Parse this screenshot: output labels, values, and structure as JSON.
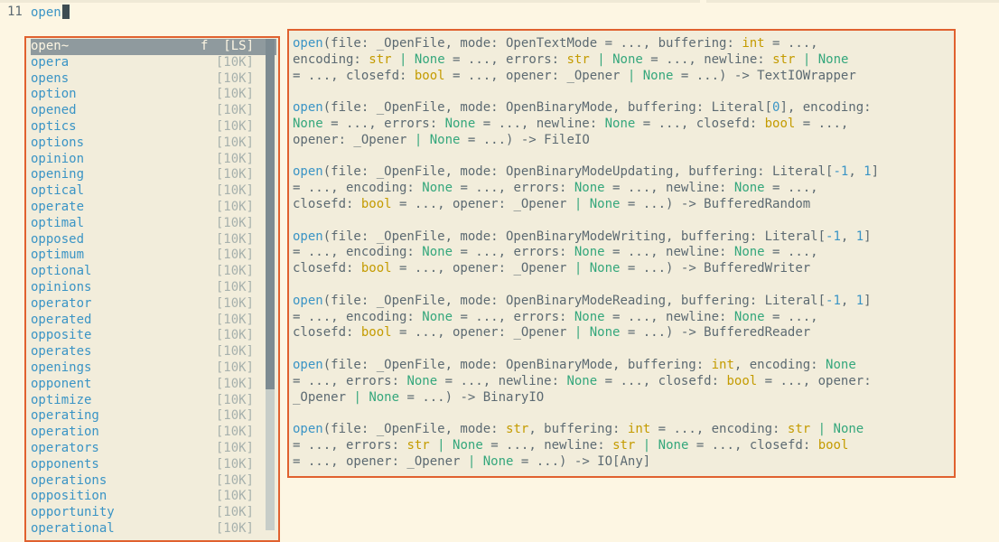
{
  "editor": {
    "line_number": "11",
    "typed_text": "open"
  },
  "completion": {
    "selected": {
      "word": "open~",
      "kind": "f",
      "menu": "[LS]"
    },
    "match_prefix_lengths_note": "",
    "items": [
      {
        "match": "op",
        "rest": "era",
        "menu": "[10K]"
      },
      {
        "match": "op",
        "rest": "ens",
        "menu": "[10K]"
      },
      {
        "match": "op",
        "rest": "tion",
        "menu": "[10K]"
      },
      {
        "match": "op",
        "rest": "ened",
        "menu": "[10K]"
      },
      {
        "match": "op",
        "rest": "tics",
        "menu": "[10K]"
      },
      {
        "match": "op",
        "rest": "tions",
        "menu": "[10K]"
      },
      {
        "match": "op",
        "rest": "inion",
        "menu": "[10K]"
      },
      {
        "match": "op",
        "rest": "ening",
        "menu": "[10K]"
      },
      {
        "match": "op",
        "rest": "tical",
        "menu": "[10K]"
      },
      {
        "match": "op",
        "rest": "erate",
        "menu": "[10K]"
      },
      {
        "match": "op",
        "rest": "timal",
        "menu": "[10K]"
      },
      {
        "match": "op",
        "rest": "posed",
        "menu": "[10K]"
      },
      {
        "match": "op",
        "rest": "timum",
        "menu": "[10K]"
      },
      {
        "match": "op",
        "rest": "tional",
        "menu": "[10K]"
      },
      {
        "match": "op",
        "rest": "inions",
        "menu": "[10K]"
      },
      {
        "match": "op",
        "rest": "erator",
        "menu": "[10K]"
      },
      {
        "match": "op",
        "rest": "erated",
        "menu": "[10K]"
      },
      {
        "match": "op",
        "rest": "posite",
        "menu": "[10K]"
      },
      {
        "match": "op",
        "rest": "erates",
        "menu": "[10K]"
      },
      {
        "match": "op",
        "rest": "enings",
        "menu": "[10K]"
      },
      {
        "match": "op",
        "rest": "ponent",
        "menu": "[10K]"
      },
      {
        "match": "op",
        "rest": "timize",
        "menu": "[10K]"
      },
      {
        "match": "op",
        "rest": "erating",
        "menu": "[10K]"
      },
      {
        "match": "op",
        "rest": "eration",
        "menu": "[10K]"
      },
      {
        "match": "op",
        "rest": "erators",
        "menu": "[10K]"
      },
      {
        "match": "op",
        "rest": "ponents",
        "menu": "[10K]"
      },
      {
        "match": "op",
        "rest": "erations",
        "menu": "[10K]"
      },
      {
        "match": "op",
        "rest": "position",
        "menu": "[10K]"
      },
      {
        "match": "op",
        "rest": "portunity",
        "menu": "[10K]"
      },
      {
        "match": "op",
        "rest": "erational",
        "menu": "[10K]"
      }
    ],
    "scroll_position_fraction": 0.0,
    "scroll_visible_fraction": 0.71
  },
  "documentation": {
    "signatures": [
      [
        [
          [
            "fn",
            "open"
          ],
          [
            "p",
            "(file: _OpenFile, mode: OpenTextMode = ..., buffering: "
          ],
          [
            "ty",
            "int"
          ],
          [
            "p",
            " = ...,"
          ]
        ],
        [
          [
            "p",
            "encoding: "
          ],
          [
            "ty",
            "str"
          ],
          [
            "p",
            " "
          ],
          [
            "pipe",
            "|"
          ],
          [
            "p",
            " "
          ],
          [
            "none",
            "None"
          ],
          [
            "p",
            " = ..., errors: "
          ],
          [
            "ty",
            "str"
          ],
          [
            "p",
            " "
          ],
          [
            "pipe",
            "|"
          ],
          [
            "p",
            " "
          ],
          [
            "none",
            "None"
          ],
          [
            "p",
            " = ..., newline: "
          ],
          [
            "ty",
            "str"
          ],
          [
            "p",
            " "
          ],
          [
            "pipe",
            "|"
          ],
          [
            "p",
            " "
          ],
          [
            "none",
            "None"
          ]
        ],
        [
          [
            "p",
            "= ..., closefd: "
          ],
          [
            "ty",
            "bool"
          ],
          [
            "p",
            " = ..., opener: _Opener "
          ],
          [
            "pipe",
            "|"
          ],
          [
            "p",
            " "
          ],
          [
            "none",
            "None"
          ],
          [
            "p",
            " = ...) -> TextIOWrapper"
          ]
        ]
      ],
      [
        [
          [
            "fn",
            "open"
          ],
          [
            "p",
            "(file: _OpenFile, mode: OpenBinaryMode, buffering: Literal["
          ],
          [
            "num",
            "0"
          ],
          [
            "p",
            "], encoding:"
          ]
        ],
        [
          [
            "none",
            "None"
          ],
          [
            "p",
            " = ..., errors: "
          ],
          [
            "none",
            "None"
          ],
          [
            "p",
            " = ..., newline: "
          ],
          [
            "none",
            "None"
          ],
          [
            "p",
            " = ..., closefd: "
          ],
          [
            "ty",
            "bool"
          ],
          [
            "p",
            " = ...,"
          ]
        ],
        [
          [
            "p",
            "opener: _Opener "
          ],
          [
            "pipe",
            "|"
          ],
          [
            "p",
            " "
          ],
          [
            "none",
            "None"
          ],
          [
            "p",
            " = ...) -> FileIO"
          ]
        ]
      ],
      [
        [
          [
            "fn",
            "open"
          ],
          [
            "p",
            "(file: _OpenFile, mode: OpenBinaryModeUpdating, buffering: Literal["
          ],
          [
            "num",
            "-1"
          ],
          [
            "p",
            ", "
          ],
          [
            "num",
            "1"
          ],
          [
            "p",
            "]"
          ]
        ],
        [
          [
            "p",
            "= ..., encoding: "
          ],
          [
            "none",
            "None"
          ],
          [
            "p",
            " = ..., errors: "
          ],
          [
            "none",
            "None"
          ],
          [
            "p",
            " = ..., newline: "
          ],
          [
            "none",
            "None"
          ],
          [
            "p",
            " = ...,"
          ]
        ],
        [
          [
            "p",
            "closefd: "
          ],
          [
            "ty",
            "bool"
          ],
          [
            "p",
            " = ..., opener: _Opener "
          ],
          [
            "pipe",
            "|"
          ],
          [
            "p",
            " "
          ],
          [
            "none",
            "None"
          ],
          [
            "p",
            " = ...) -> BufferedRandom"
          ]
        ]
      ],
      [
        [
          [
            "fn",
            "open"
          ],
          [
            "p",
            "(file: _OpenFile, mode: OpenBinaryModeWriting, buffering: Literal["
          ],
          [
            "num",
            "-1"
          ],
          [
            "p",
            ", "
          ],
          [
            "num",
            "1"
          ],
          [
            "p",
            "]"
          ]
        ],
        [
          [
            "p",
            "= ..., encoding: "
          ],
          [
            "none",
            "None"
          ],
          [
            "p",
            " = ..., errors: "
          ],
          [
            "none",
            "None"
          ],
          [
            "p",
            " = ..., newline: "
          ],
          [
            "none",
            "None"
          ],
          [
            "p",
            " = ...,"
          ]
        ],
        [
          [
            "p",
            "closefd: "
          ],
          [
            "ty",
            "bool"
          ],
          [
            "p",
            " = ..., opener: _Opener "
          ],
          [
            "pipe",
            "|"
          ],
          [
            "p",
            " "
          ],
          [
            "none",
            "None"
          ],
          [
            "p",
            " = ...) -> BufferedWriter"
          ]
        ]
      ],
      [
        [
          [
            "fn",
            "open"
          ],
          [
            "p",
            "(file: _OpenFile, mode: OpenBinaryModeReading, buffering: Literal["
          ],
          [
            "num",
            "-1"
          ],
          [
            "p",
            ", "
          ],
          [
            "num",
            "1"
          ],
          [
            "p",
            "]"
          ]
        ],
        [
          [
            "p",
            "= ..., encoding: "
          ],
          [
            "none",
            "None"
          ],
          [
            "p",
            " = ..., errors: "
          ],
          [
            "none",
            "None"
          ],
          [
            "p",
            " = ..., newline: "
          ],
          [
            "none",
            "None"
          ],
          [
            "p",
            " = ...,"
          ]
        ],
        [
          [
            "p",
            "closefd: "
          ],
          [
            "ty",
            "bool"
          ],
          [
            "p",
            " = ..., opener: _Opener "
          ],
          [
            "pipe",
            "|"
          ],
          [
            "p",
            " "
          ],
          [
            "none",
            "None"
          ],
          [
            "p",
            " = ...) -> BufferedReader"
          ]
        ]
      ],
      [
        [
          [
            "fn",
            "open"
          ],
          [
            "p",
            "(file: _OpenFile, mode: OpenBinaryMode, buffering: "
          ],
          [
            "ty",
            "int"
          ],
          [
            "p",
            ", encoding: "
          ],
          [
            "none",
            "None"
          ]
        ],
        [
          [
            "p",
            "= ..., errors: "
          ],
          [
            "none",
            "None"
          ],
          [
            "p",
            " = ..., newline: "
          ],
          [
            "none",
            "None"
          ],
          [
            "p",
            " = ..., closefd: "
          ],
          [
            "ty",
            "bool"
          ],
          [
            "p",
            " = ..., opener:"
          ]
        ],
        [
          [
            "p",
            "_Opener "
          ],
          [
            "pipe",
            "|"
          ],
          [
            "p",
            " "
          ],
          [
            "none",
            "None"
          ],
          [
            "p",
            " = ...) -> BinaryIO"
          ]
        ]
      ],
      [
        [
          [
            "fn",
            "open"
          ],
          [
            "p",
            "(file: _OpenFile, mode: "
          ],
          [
            "ty",
            "str"
          ],
          [
            "p",
            ", buffering: "
          ],
          [
            "ty",
            "int"
          ],
          [
            "p",
            " = ..., encoding: "
          ],
          [
            "ty",
            "str"
          ],
          [
            "p",
            " "
          ],
          [
            "pipe",
            "|"
          ],
          [
            "p",
            " "
          ],
          [
            "none",
            "None"
          ]
        ],
        [
          [
            "p",
            "= ..., errors: "
          ],
          [
            "ty",
            "str"
          ],
          [
            "p",
            " "
          ],
          [
            "pipe",
            "|"
          ],
          [
            "p",
            " "
          ],
          [
            "none",
            "None"
          ],
          [
            "p",
            " = ..., newline: "
          ],
          [
            "ty",
            "str"
          ],
          [
            "p",
            " "
          ],
          [
            "pipe",
            "|"
          ],
          [
            "p",
            " "
          ],
          [
            "none",
            "None"
          ],
          [
            "p",
            " = ..., closefd: "
          ],
          [
            "ty",
            "bool"
          ]
        ],
        [
          [
            "p",
            "= ..., opener: _Opener "
          ],
          [
            "pipe",
            "|"
          ],
          [
            "p",
            " "
          ],
          [
            "none",
            "None"
          ],
          [
            "p",
            " = ...) -> IO[Any]"
          ]
        ]
      ]
    ]
  },
  "colors": {
    "background": "#fdf6e3",
    "popup_bg": "#f2eddb",
    "border": "#e0612f",
    "function": "#3a94c5",
    "type": "#c49b00",
    "none": "#35a77c",
    "text": "#5c6a72",
    "selected_bg": "#8f9a9e"
  }
}
